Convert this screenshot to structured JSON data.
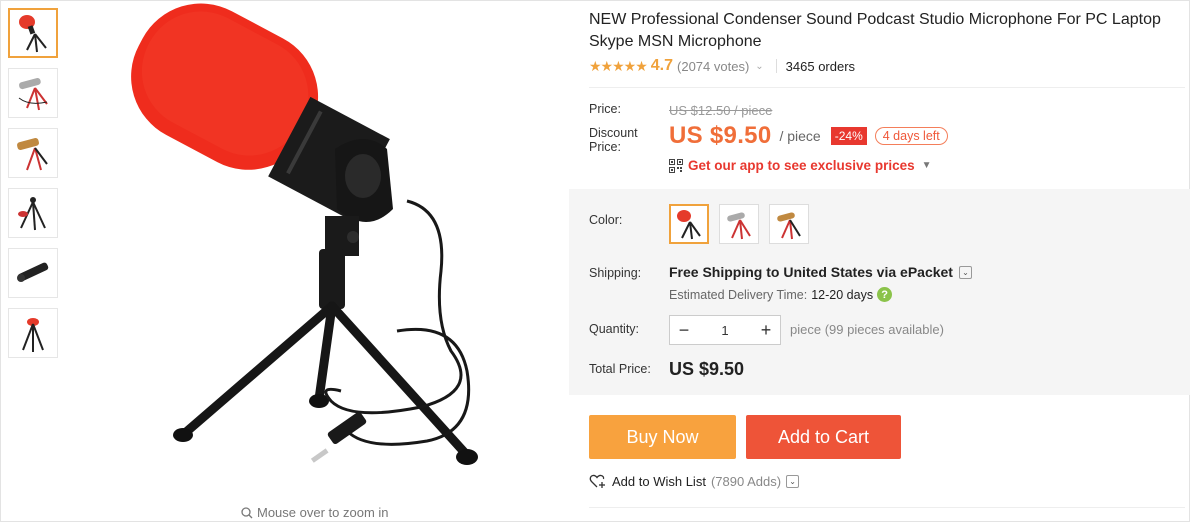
{
  "product": {
    "title": "NEW Professional Condenser Sound Podcast Studio Microphone For PC Laptop Skype MSN Microphone",
    "stars": "★★★★★",
    "rating": "4.7",
    "votes": "(2074 votes)",
    "orders": "3465 orders"
  },
  "pricing": {
    "price_label": "Price:",
    "original_price": "US $12.50 / piece",
    "discount_label": "Discount Price:",
    "discount_price": "US $9.50",
    "per_piece": "/ piece",
    "discount_pct": "-24%",
    "days_left": "4 days left",
    "app_promo": "Get our app to see exclusive prices"
  },
  "options": {
    "color_label": "Color:",
    "colors": [
      "red",
      "silver",
      "brown"
    ]
  },
  "shipping": {
    "label": "Shipping:",
    "method": "Free Shipping to United States via ePacket",
    "delivery_label": "Estimated Delivery Time:",
    "delivery_time": "12-20 days"
  },
  "quantity": {
    "label": "Quantity:",
    "value": "1",
    "available": "piece (99 pieces available)"
  },
  "total": {
    "label": "Total Price:",
    "value": "US $9.50"
  },
  "actions": {
    "buy_now": "Buy Now",
    "add_to_cart": "Add to Cart",
    "wish_list": "Add to Wish List",
    "wish_count": "(7890 Adds)"
  },
  "gallery": {
    "zoom_hint": "Mouse over to zoom in",
    "thumbnail_count": 6
  },
  "colors": {
    "accent_orange": "#f0a23c",
    "price_orange": "#f06e39",
    "cart_red": "#ee5438",
    "badge_red": "#e8382f"
  }
}
